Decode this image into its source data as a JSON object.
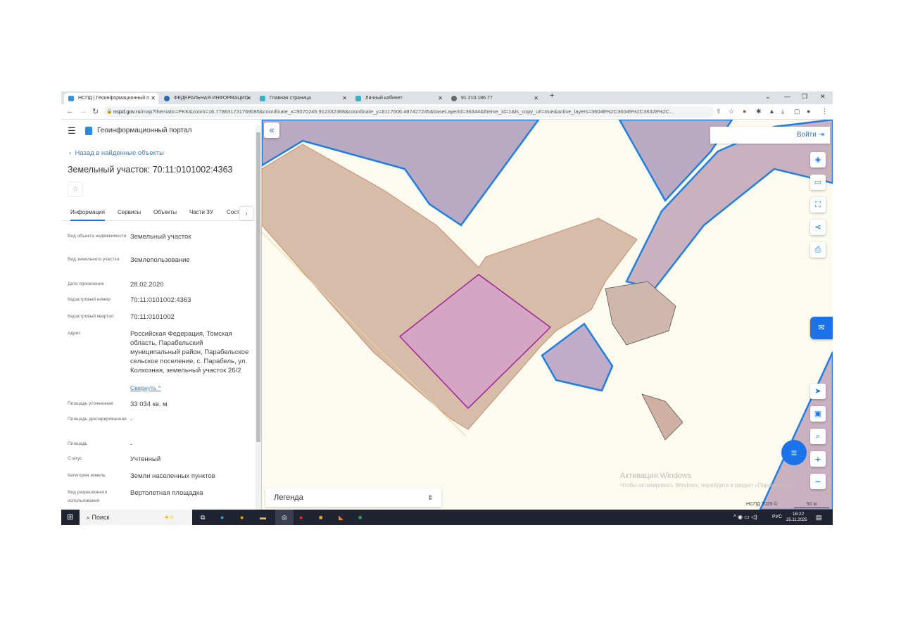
{
  "browser": {
    "tabs": [
      {
        "title": "НСПД | Геоинформационный п",
        "active": true
      },
      {
        "title": "ФЕДЕРАЛЬНАЯ ИНФОРМАЦИО",
        "active": false
      },
      {
        "title": "Главная страница",
        "active": false
      },
      {
        "title": "Личный кабинет",
        "active": false
      },
      {
        "title": "91.210.186.77",
        "active": false
      }
    ],
    "new_tab": "+",
    "url_domain": "nspd.gov.ru",
    "url_rest": "/map?thematic=PKK&zoom=16.778831731769085&coordinate_x=9070245.912332368&coordinate_y=8117606.487427245&baseLayerId=36344&theme_id=1&is_copy_url=true&active_layers=36048%2C36049%2C36328%2C..."
  },
  "panel": {
    "portal_title": "Геоинформационный портал",
    "back_link": "Назад в найденные объекты",
    "title": "Земельный участок: 70:11:0101002:4363",
    "tabs": [
      "Информация",
      "Сервисы",
      "Объекты",
      "Части ЗУ",
      "Сост"
    ],
    "fields": [
      {
        "label": "Вид объекта недвижимости",
        "value": "Земельный участок"
      },
      {
        "label": "Вид земельного участка",
        "value": "Землепользование"
      },
      {
        "label": "Дата присвоения",
        "value": "28.02.2020"
      },
      {
        "label": "Кадастровый номер",
        "value": "70:11:0101002:4363"
      },
      {
        "label": "Кадастровый квартал",
        "value": "70:11:0101002"
      },
      {
        "label": "Адрес",
        "value": "Российская Федерация, Томская область, Парабельский муниципальный район, Парабельское сельское поселение, с. Парабель, ул. Колхозная, земельный участок 26/2"
      },
      {
        "label": "Площадь уточненная",
        "value": "33 034 кв. м"
      },
      {
        "label": "Площадь декларированная",
        "value": "-"
      },
      {
        "label": "Площадь",
        "value": "-"
      },
      {
        "label": "Статус",
        "value": "Учтенный"
      },
      {
        "label": "Категория земель",
        "value": "Земли населенных пунктов"
      },
      {
        "label": "Вид разрешенного использования",
        "value": "Вертолетная площадка"
      }
    ],
    "collapse_link": "Свернуть"
  },
  "map": {
    "login": "Войти",
    "legend": "Легенда",
    "copyright": "НСПД 2025 ©",
    "scale": "50 м",
    "zoom_in": "+",
    "zoom_out": "−",
    "watermark_title": "Активация Windows",
    "watermark_text": "Чтобы активировать Windows, перейдите в раздел «Параметры»."
  },
  "taskbar": {
    "search": "Поиск",
    "lang": "РУС",
    "time": "16:22",
    "date": "25.11.2025"
  }
}
